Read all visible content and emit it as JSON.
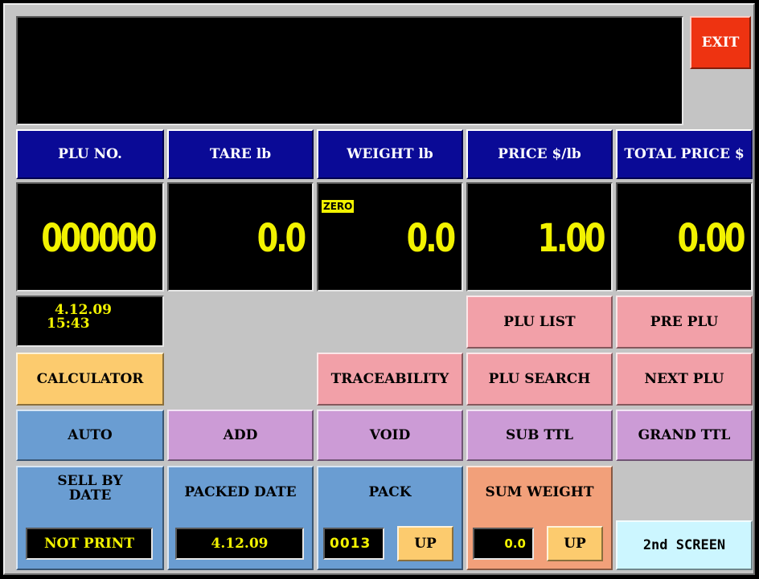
{
  "exit_label": "EXIT",
  "headers": {
    "plu_no": "PLU NO.",
    "tare": "TARE lb",
    "weight": "WEIGHT lb",
    "price": "PRICE $/lb",
    "total": "TOTAL PRICE $"
  },
  "values": {
    "plu_no": "000000",
    "tare": "0.0",
    "weight": "0.0",
    "price": "1.00",
    "total": "0.00"
  },
  "zero_badge": "ZERO",
  "datetime": {
    "date": "4.12.09",
    "time": "15:43"
  },
  "buttons": {
    "plu_list": "PLU LIST",
    "pre_plu": "PRE PLU",
    "calculator": "CALCULATOR",
    "traceability": "TRACEABILITY",
    "plu_search": "PLU SEARCH",
    "next_plu": "NEXT PLU",
    "auto": "AUTO",
    "add": "ADD",
    "void": "VOID",
    "sub_ttl": "SUB TTL",
    "grand_ttl": "GRAND TTL",
    "second_screen": "2nd SCREEN"
  },
  "sell_by": {
    "label_line1": "SELL BY",
    "label_line2": "DATE",
    "value": "NOT PRINT"
  },
  "packed_date": {
    "label": "PACKED DATE",
    "value": "4.12.09"
  },
  "pack": {
    "label": "PACK",
    "value": "0013",
    "up_label": "UP"
  },
  "sum_weight": {
    "label": "SUM WEIGHT",
    "value": "0.0",
    "up_label": "UP"
  },
  "colors": {
    "header_blue": "#0a0a96",
    "display_yellow": "#f2f200",
    "exit_red": "#ee3311",
    "frame_gray": "#c4c4c4"
  }
}
